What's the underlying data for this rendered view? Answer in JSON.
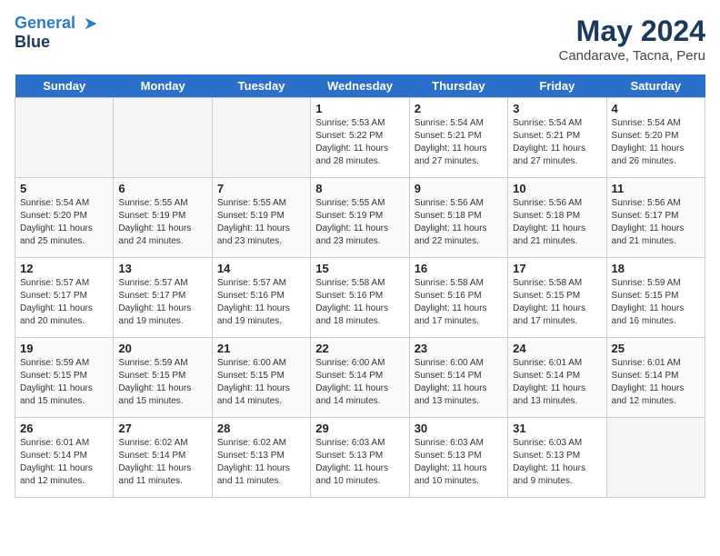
{
  "header": {
    "logo_line1": "General",
    "logo_line2": "Blue",
    "title": "May 2024",
    "subtitle": "Candarave, Tacna, Peru"
  },
  "days_of_week": [
    "Sunday",
    "Monday",
    "Tuesday",
    "Wednesday",
    "Thursday",
    "Friday",
    "Saturday"
  ],
  "weeks": [
    [
      {
        "day": "",
        "info": ""
      },
      {
        "day": "",
        "info": ""
      },
      {
        "day": "",
        "info": ""
      },
      {
        "day": "1",
        "info": "Sunrise: 5:53 AM\nSunset: 5:22 PM\nDaylight: 11 hours and 28 minutes."
      },
      {
        "day": "2",
        "info": "Sunrise: 5:54 AM\nSunset: 5:21 PM\nDaylight: 11 hours and 27 minutes."
      },
      {
        "day": "3",
        "info": "Sunrise: 5:54 AM\nSunset: 5:21 PM\nDaylight: 11 hours and 27 minutes."
      },
      {
        "day": "4",
        "info": "Sunrise: 5:54 AM\nSunset: 5:20 PM\nDaylight: 11 hours and 26 minutes."
      }
    ],
    [
      {
        "day": "5",
        "info": "Sunrise: 5:54 AM\nSunset: 5:20 PM\nDaylight: 11 hours and 25 minutes."
      },
      {
        "day": "6",
        "info": "Sunrise: 5:55 AM\nSunset: 5:19 PM\nDaylight: 11 hours and 24 minutes."
      },
      {
        "day": "7",
        "info": "Sunrise: 5:55 AM\nSunset: 5:19 PM\nDaylight: 11 hours and 23 minutes."
      },
      {
        "day": "8",
        "info": "Sunrise: 5:55 AM\nSunset: 5:19 PM\nDaylight: 11 hours and 23 minutes."
      },
      {
        "day": "9",
        "info": "Sunrise: 5:56 AM\nSunset: 5:18 PM\nDaylight: 11 hours and 22 minutes."
      },
      {
        "day": "10",
        "info": "Sunrise: 5:56 AM\nSunset: 5:18 PM\nDaylight: 11 hours and 21 minutes."
      },
      {
        "day": "11",
        "info": "Sunrise: 5:56 AM\nSunset: 5:17 PM\nDaylight: 11 hours and 21 minutes."
      }
    ],
    [
      {
        "day": "12",
        "info": "Sunrise: 5:57 AM\nSunset: 5:17 PM\nDaylight: 11 hours and 20 minutes."
      },
      {
        "day": "13",
        "info": "Sunrise: 5:57 AM\nSunset: 5:17 PM\nDaylight: 11 hours and 19 minutes."
      },
      {
        "day": "14",
        "info": "Sunrise: 5:57 AM\nSunset: 5:16 PM\nDaylight: 11 hours and 19 minutes."
      },
      {
        "day": "15",
        "info": "Sunrise: 5:58 AM\nSunset: 5:16 PM\nDaylight: 11 hours and 18 minutes."
      },
      {
        "day": "16",
        "info": "Sunrise: 5:58 AM\nSunset: 5:16 PM\nDaylight: 11 hours and 17 minutes."
      },
      {
        "day": "17",
        "info": "Sunrise: 5:58 AM\nSunset: 5:15 PM\nDaylight: 11 hours and 17 minutes."
      },
      {
        "day": "18",
        "info": "Sunrise: 5:59 AM\nSunset: 5:15 PM\nDaylight: 11 hours and 16 minutes."
      }
    ],
    [
      {
        "day": "19",
        "info": "Sunrise: 5:59 AM\nSunset: 5:15 PM\nDaylight: 11 hours and 15 minutes."
      },
      {
        "day": "20",
        "info": "Sunrise: 5:59 AM\nSunset: 5:15 PM\nDaylight: 11 hours and 15 minutes."
      },
      {
        "day": "21",
        "info": "Sunrise: 6:00 AM\nSunset: 5:15 PM\nDaylight: 11 hours and 14 minutes."
      },
      {
        "day": "22",
        "info": "Sunrise: 6:00 AM\nSunset: 5:14 PM\nDaylight: 11 hours and 14 minutes."
      },
      {
        "day": "23",
        "info": "Sunrise: 6:00 AM\nSunset: 5:14 PM\nDaylight: 11 hours and 13 minutes."
      },
      {
        "day": "24",
        "info": "Sunrise: 6:01 AM\nSunset: 5:14 PM\nDaylight: 11 hours and 13 minutes."
      },
      {
        "day": "25",
        "info": "Sunrise: 6:01 AM\nSunset: 5:14 PM\nDaylight: 11 hours and 12 minutes."
      }
    ],
    [
      {
        "day": "26",
        "info": "Sunrise: 6:01 AM\nSunset: 5:14 PM\nDaylight: 11 hours and 12 minutes."
      },
      {
        "day": "27",
        "info": "Sunrise: 6:02 AM\nSunset: 5:14 PM\nDaylight: 11 hours and 11 minutes."
      },
      {
        "day": "28",
        "info": "Sunrise: 6:02 AM\nSunset: 5:13 PM\nDaylight: 11 hours and 11 minutes."
      },
      {
        "day": "29",
        "info": "Sunrise: 6:03 AM\nSunset: 5:13 PM\nDaylight: 11 hours and 10 minutes."
      },
      {
        "day": "30",
        "info": "Sunrise: 6:03 AM\nSunset: 5:13 PM\nDaylight: 11 hours and 10 minutes."
      },
      {
        "day": "31",
        "info": "Sunrise: 6:03 AM\nSunset: 5:13 PM\nDaylight: 11 hours and 9 minutes."
      },
      {
        "day": "",
        "info": ""
      }
    ]
  ]
}
